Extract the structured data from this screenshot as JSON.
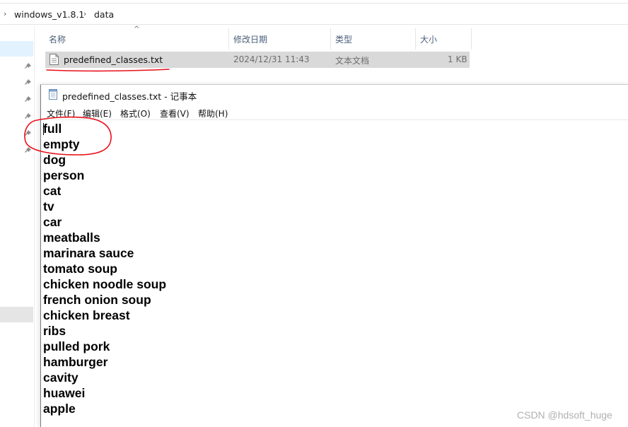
{
  "explorer": {
    "breadcrumb": [
      "windows_v1.8.1",
      "data"
    ],
    "columns": {
      "name": "名称",
      "date": "修改日期",
      "type": "类型",
      "size": "大小"
    },
    "file": {
      "name": "predefined_classes.txt",
      "date": "2024/12/31 11:43",
      "type": "文本文档",
      "size": "1 KB"
    }
  },
  "notepad": {
    "title": "predefined_classes.txt - 记事本",
    "menu": [
      "文件(F)",
      "编辑(E)",
      "格式(O)",
      "查看(V)",
      "帮助(H)"
    ],
    "lines": [
      "full",
      "empty",
      "dog",
      "person",
      "cat",
      "tv",
      "car",
      "meatballs",
      "marinara sauce",
      "tomato soup",
      "chicken noodle soup",
      "french onion soup",
      "chicken breast",
      "ribs",
      "pulled pork",
      "hamburger",
      "cavity",
      "huawei",
      "apple"
    ]
  },
  "watermark": "CSDN @hdsoft_huge",
  "colors": {
    "annotation": "#e8101a",
    "selection": "#d9d9d9"
  }
}
